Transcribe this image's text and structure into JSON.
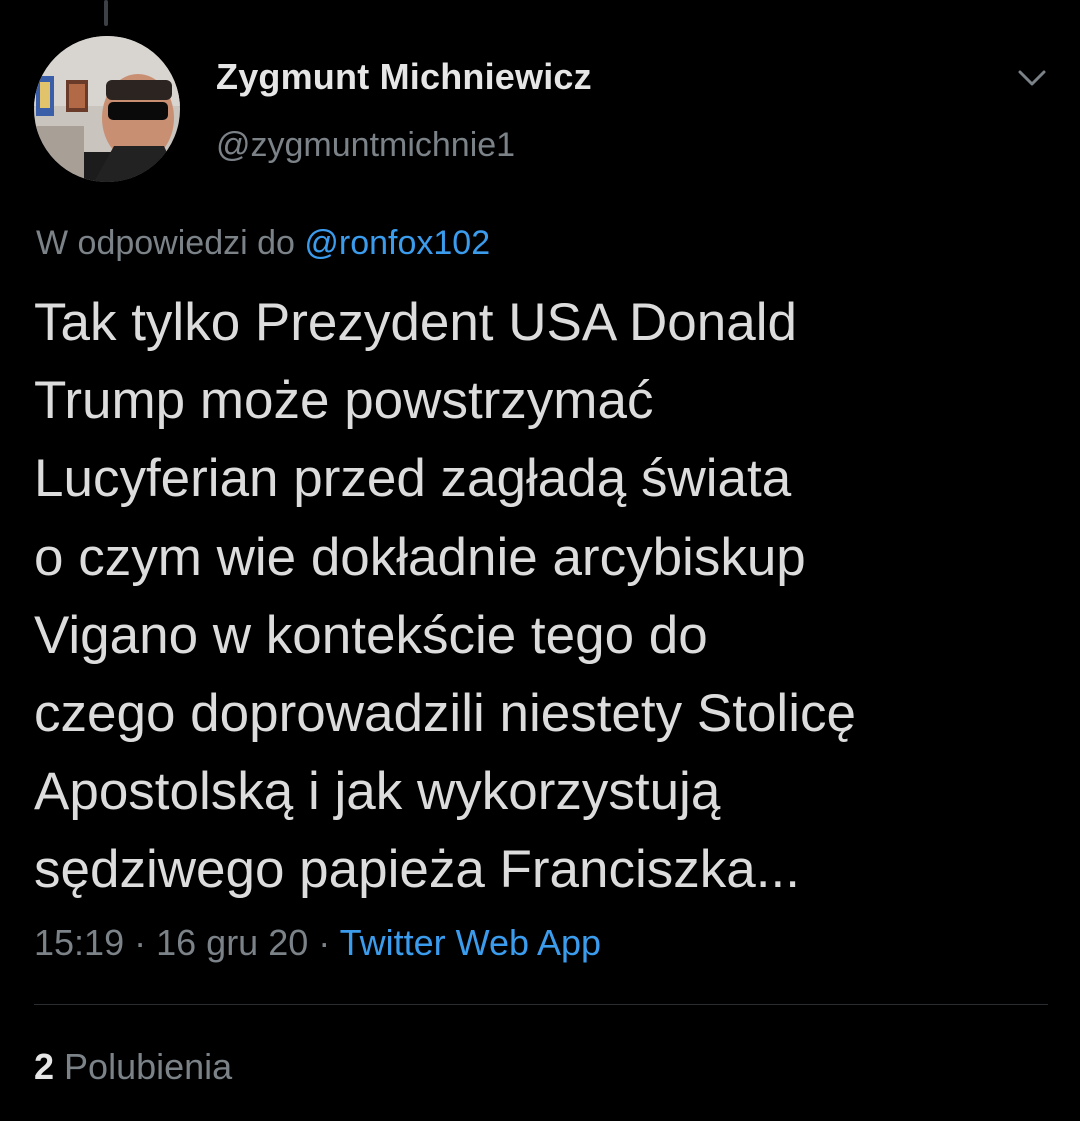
{
  "tweet": {
    "author": {
      "display_name": "Zygmunt Michniewicz",
      "handle": "@zygmuntmichnie1",
      "avatar": "profile-photo"
    },
    "menu_icon": "chevron-down-icon",
    "reply_context": {
      "prefix": "W odpowiedzi do",
      "mention": "@ronfox102"
    },
    "text_lines": [
      "Tak tylko Prezydent USA Donald",
      "Trump może powstrzymać",
      "Lucyferian przed zagładą świata",
      "o czym wie dokładnie arcybiskup",
      "Vigano w kontekście tego do",
      "czego doprowadzili niestety Stolicę",
      "Apostolską i jak wykorzystują",
      "sędziwego papieża Franciszka..."
    ],
    "time": "15:19",
    "separator": "·",
    "date": "16 gru 20",
    "source": "Twitter Web App",
    "likes": {
      "count": "2",
      "label": "Polubienia"
    }
  },
  "colors": {
    "background": "#000000",
    "primary_text": "#dcdcdc",
    "secondary_text": "#7b8288",
    "link": "#3b9ced",
    "divider": "#2b2e31"
  }
}
